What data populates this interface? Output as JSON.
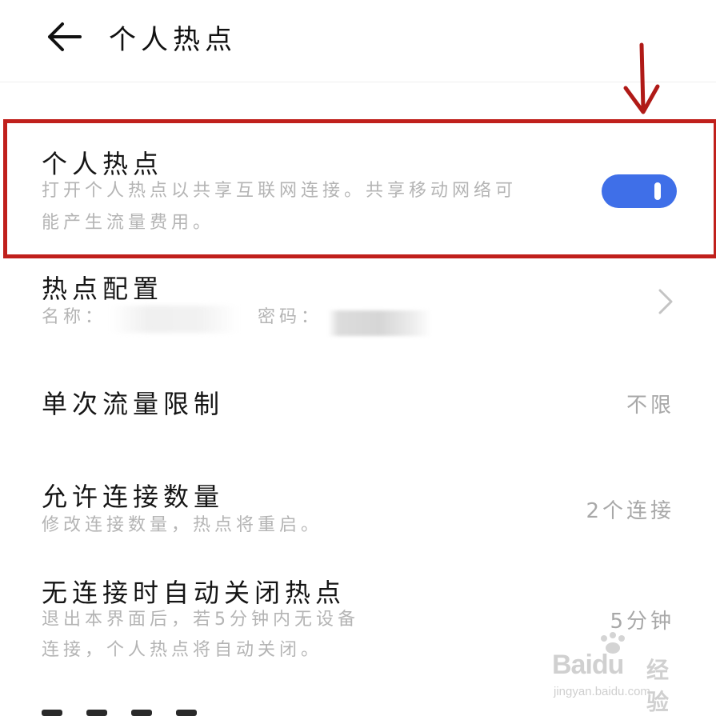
{
  "header": {
    "title": "个人热点",
    "back_icon": "arrow-left-icon"
  },
  "hotspot": {
    "title": "个人热点",
    "description_line1": "打开个人热点以共享互联网连接。共享移动网络可",
    "description_line2": "能产生流量费用。",
    "toggle_on": true,
    "accent_color": "#3f6fe8",
    "highlight_color": "#c0201c",
    "annotation_icon": "red-arrow-down-icon"
  },
  "config": {
    "title": "热点配置",
    "name_label": "名称：",
    "password_label": "密码：",
    "chevron_icon": "chevron-right-icon"
  },
  "data_limit": {
    "title": "单次流量限制",
    "value": "不限"
  },
  "connections": {
    "title": "允许连接数量",
    "description": "修改连接数量，热点将重启。",
    "value": "2个连接"
  },
  "auto_close": {
    "title": "无连接时自动关闭热点",
    "description_line1": "退出本界面后，若5分钟内无设备",
    "description_line2": "连接，个人热点将自动关闭。",
    "value": "5分钟"
  },
  "watermark": {
    "brand": "Baidu",
    "suffix": "经验",
    "url": "jingyan.baidu.com"
  }
}
